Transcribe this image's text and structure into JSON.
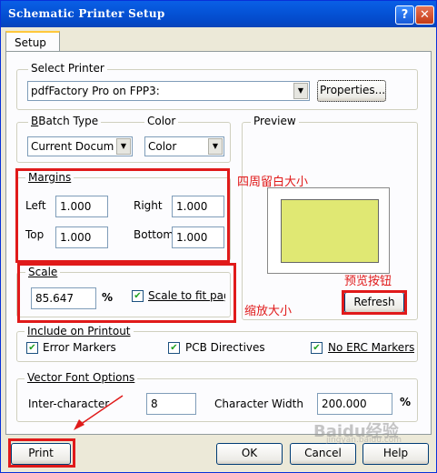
{
  "window": {
    "title": "Schematic Printer Setup",
    "help_label": "?",
    "close_label": "✕"
  },
  "tabs": [
    {
      "label": "Setup"
    }
  ],
  "select_printer": {
    "label": "Select Printer",
    "value": "pdfFactory Pro on FPP3:",
    "properties_label": "Properties..."
  },
  "batch_type": {
    "label": "Batch Type",
    "value": "Current Docum"
  },
  "color": {
    "label": "Color",
    "value": "Color"
  },
  "margins": {
    "label": "Margins",
    "left_label": "Left",
    "left_value": "1.000",
    "right_label": "Right",
    "right_value": "1.000",
    "top_label": "Top",
    "top_value": "1.000",
    "bottom_label": "Bottom",
    "bottom_value": "1.000"
  },
  "preview": {
    "label": "Preview",
    "refresh_label": "Refresh"
  },
  "scale": {
    "label": "Scale",
    "value": "85.647",
    "unit": "%",
    "fit_label": "Scale to fit page",
    "fit_checked": true
  },
  "include": {
    "label": "Include on Printout",
    "items": [
      {
        "label": "Error Markers",
        "checked": true
      },
      {
        "label": "PCB Directives",
        "checked": true
      },
      {
        "label": "No ERC Markers",
        "checked": true
      }
    ]
  },
  "vector_font": {
    "label": "Vector Font Options",
    "inter_char_label": "Inter-character",
    "inter_char_value": "8",
    "char_width_label": "Character Width",
    "char_width_value": "200.000",
    "unit": "%"
  },
  "buttons": {
    "print": "Print",
    "ok": "OK",
    "cancel": "Cancel",
    "help": "Help"
  },
  "annotations": {
    "margins_note": "四周留白大小",
    "refresh_note": "预览按钮",
    "scale_note": "缩放大小"
  },
  "watermark": {
    "text": "Baidu经验",
    "sub": "jingyan.baidu.com"
  }
}
